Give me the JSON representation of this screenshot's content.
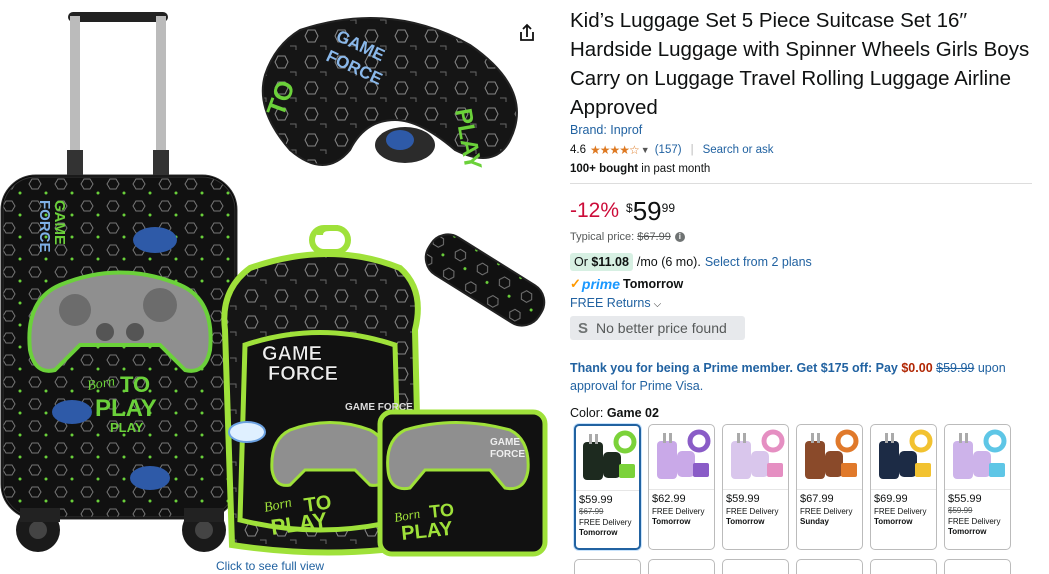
{
  "gallery": {
    "see_full_label": "Click to see full view",
    "share_icon": "share-icon",
    "art": {
      "neck_pillow": [
        "GAME",
        "FORCE",
        "TO",
        "PLAY"
      ],
      "suitcase": [
        "GAME",
        "FORCE",
        "Born",
        "TO",
        "PLAY",
        "PLAY"
      ],
      "backpack": [
        "GAME",
        "FORCE",
        "GAME FORCE",
        "Born",
        "TO",
        "PLAY"
      ],
      "lunchbox": [
        "GAME",
        "FORCE",
        "Born",
        "TO",
        "PLAY"
      ]
    }
  },
  "product": {
    "title": "Kid’s Luggage Set 5 Piece Suitcase Set 16′′ Hardside Luggage with Spinner Wheels Girls Boys Carry on Luggage Travel Rolling Luggage Airline Approved",
    "brand": "Brand: Inprof",
    "rating": "4.6",
    "rating_value": 4.6,
    "rating_count": "(157)",
    "search_ask": "Search or ask",
    "bought_bold": "100+ bought",
    "bought_rest": " in past month"
  },
  "pricing": {
    "discount": "-12%",
    "currency": "$",
    "whole": "59",
    "fraction": "99",
    "typical_label": "Typical price:",
    "typical_value": "$67.99",
    "monthly_or": "Or ",
    "monthly_amount": "$11.08",
    "monthly_rest": "/mo (6 mo).",
    "monthly_plans": "Select from 2 plans",
    "prime_label": "prime",
    "prime_delivery": "Tomorrow",
    "returns_label": "FREE Returns",
    "no_better": "No better price found"
  },
  "prime_offer": {
    "bold_part": "Thank you for being a Prime member. Get $175 off: Pay ",
    "pay_amount": "$0.00",
    "was_amount": "$59.99",
    "tail": " upon approval for Prime Visa."
  },
  "color": {
    "label": "Color: ",
    "selected": "Game 02",
    "swatches": [
      {
        "price": "$59.99",
        "was": "$67.99",
        "delivery": "FREE Delivery",
        "day": "Tomorrow",
        "bg": "#1d2a1f",
        "accent": "#7bd23a"
      },
      {
        "price": "$62.99",
        "was": "",
        "delivery": "FREE Delivery",
        "day": "Tomorrow",
        "bg": "#c9a9e8",
        "accent": "#8a5cc7"
      },
      {
        "price": "$59.99",
        "was": "",
        "delivery": "FREE Delivery",
        "day": "Tomorrow",
        "bg": "#d9c6ec",
        "accent": "#e58fc2"
      },
      {
        "price": "$67.99",
        "was": "",
        "delivery": "FREE Delivery",
        "day": "Sunday",
        "bg": "#8a4a2a",
        "accent": "#e0792b"
      },
      {
        "price": "$69.99",
        "was": "",
        "delivery": "FREE Delivery",
        "day": "Tomorrow",
        "bg": "#1c2b45",
        "accent": "#f2c230"
      },
      {
        "price": "$55.99",
        "was": "$59.99",
        "delivery": "FREE Delivery",
        "day": "Tomorrow",
        "bg": "#cdb3ea",
        "accent": "#5ec6e6"
      }
    ]
  }
}
